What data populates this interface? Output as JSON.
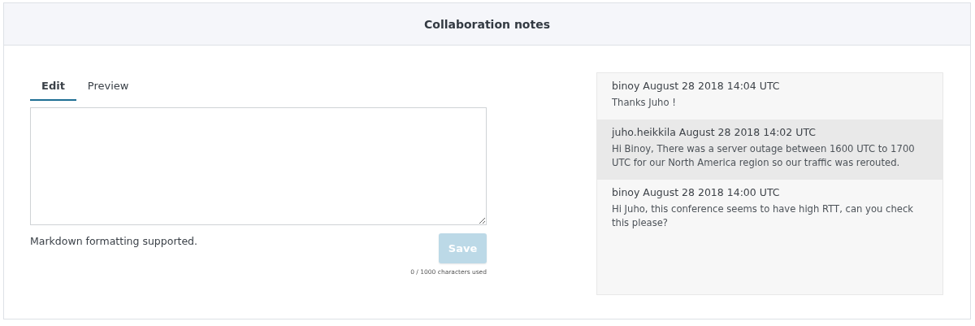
{
  "header": {
    "title": "Collaboration notes"
  },
  "tabs": [
    {
      "label": "Edit",
      "selected": true
    },
    {
      "label": "Preview",
      "selected": false
    }
  ],
  "editor": {
    "hint": "Markdown formatting supported.",
    "save_button": {
      "label": "Save",
      "disabled": true
    },
    "counter": "0 / 1000 characters used"
  },
  "comments": [
    {
      "author": "binoy",
      "timestamp": "August 28 2018 14:04 UTC",
      "text": "Thanks Juho !",
      "highlighted": false
    },
    {
      "author": "juho.heikkila",
      "timestamp": "August 28 2018 14:02 UTC",
      "text": "Hi Binoy, There was a server outage between 1600 UTC to 1700 UTC for our North America region so our traffic was rerouted.",
      "highlighted": true
    },
    {
      "author": "binoy",
      "timestamp": "August 28 2018 14:00 UTC",
      "text": "Hi Juho, this conference seems to have high RTT, can you check this please?",
      "highlighted": false
    }
  ]
}
